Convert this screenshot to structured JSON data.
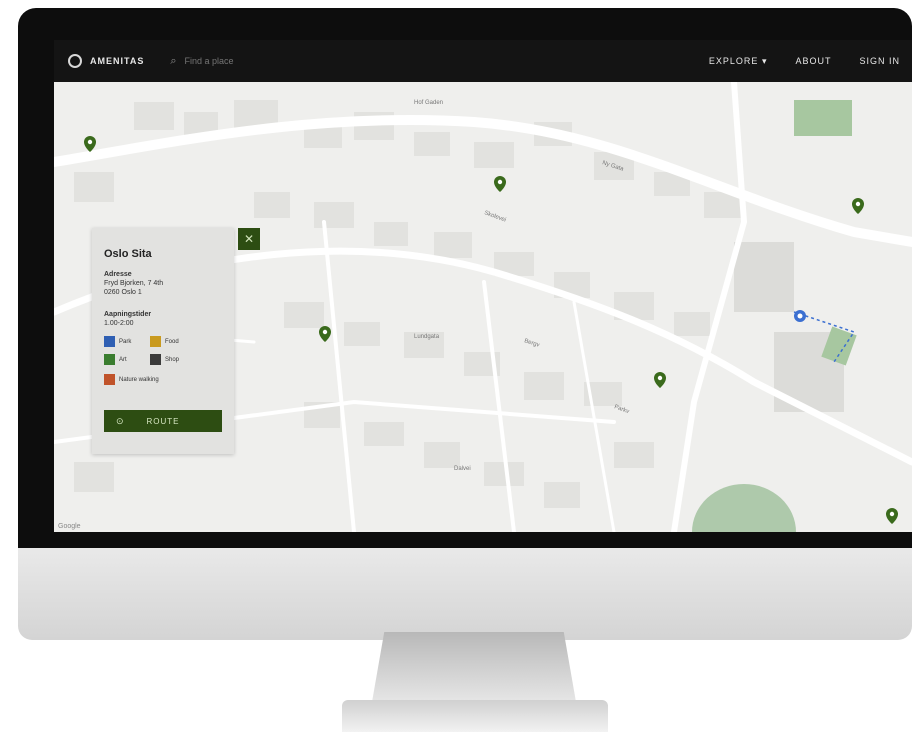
{
  "topbar": {
    "brand": "AMENITAS",
    "search_placeholder": "Find a place",
    "nav": [
      "EXPLORE ▾",
      "ABOUT",
      "SIGN IN"
    ]
  },
  "panel": {
    "title": "Oslo Sita",
    "address_label": "Adresse",
    "address_lines": [
      "Fryd Bjorken, 7 4th",
      "0260 Oslo 1"
    ],
    "hours_label": "Aapningstider",
    "hours_value": "1.00-2:00",
    "categories": [
      {
        "label": "Park",
        "color": "#2f5fb3"
      },
      {
        "label": "Food",
        "color": "#c99a1f"
      },
      {
        "label": "Art",
        "color": "#3a7d2f"
      },
      {
        "label": "Shop",
        "color": "#3b3b3b"
      },
      {
        "label": "Nature walking",
        "color": "#c0532a"
      }
    ],
    "button_label": "ROUTE",
    "close_icon": "close-icon"
  },
  "map": {
    "street_labels": [
      "Hof Gaden",
      "Ny Gata",
      "Skolevei",
      "Lundgata",
      "Bergv",
      "Parkv",
      "Dalvei"
    ],
    "attribution": "Google",
    "pin_color": "#3a6a1c",
    "location_dot_color": "#3b6fd1"
  }
}
